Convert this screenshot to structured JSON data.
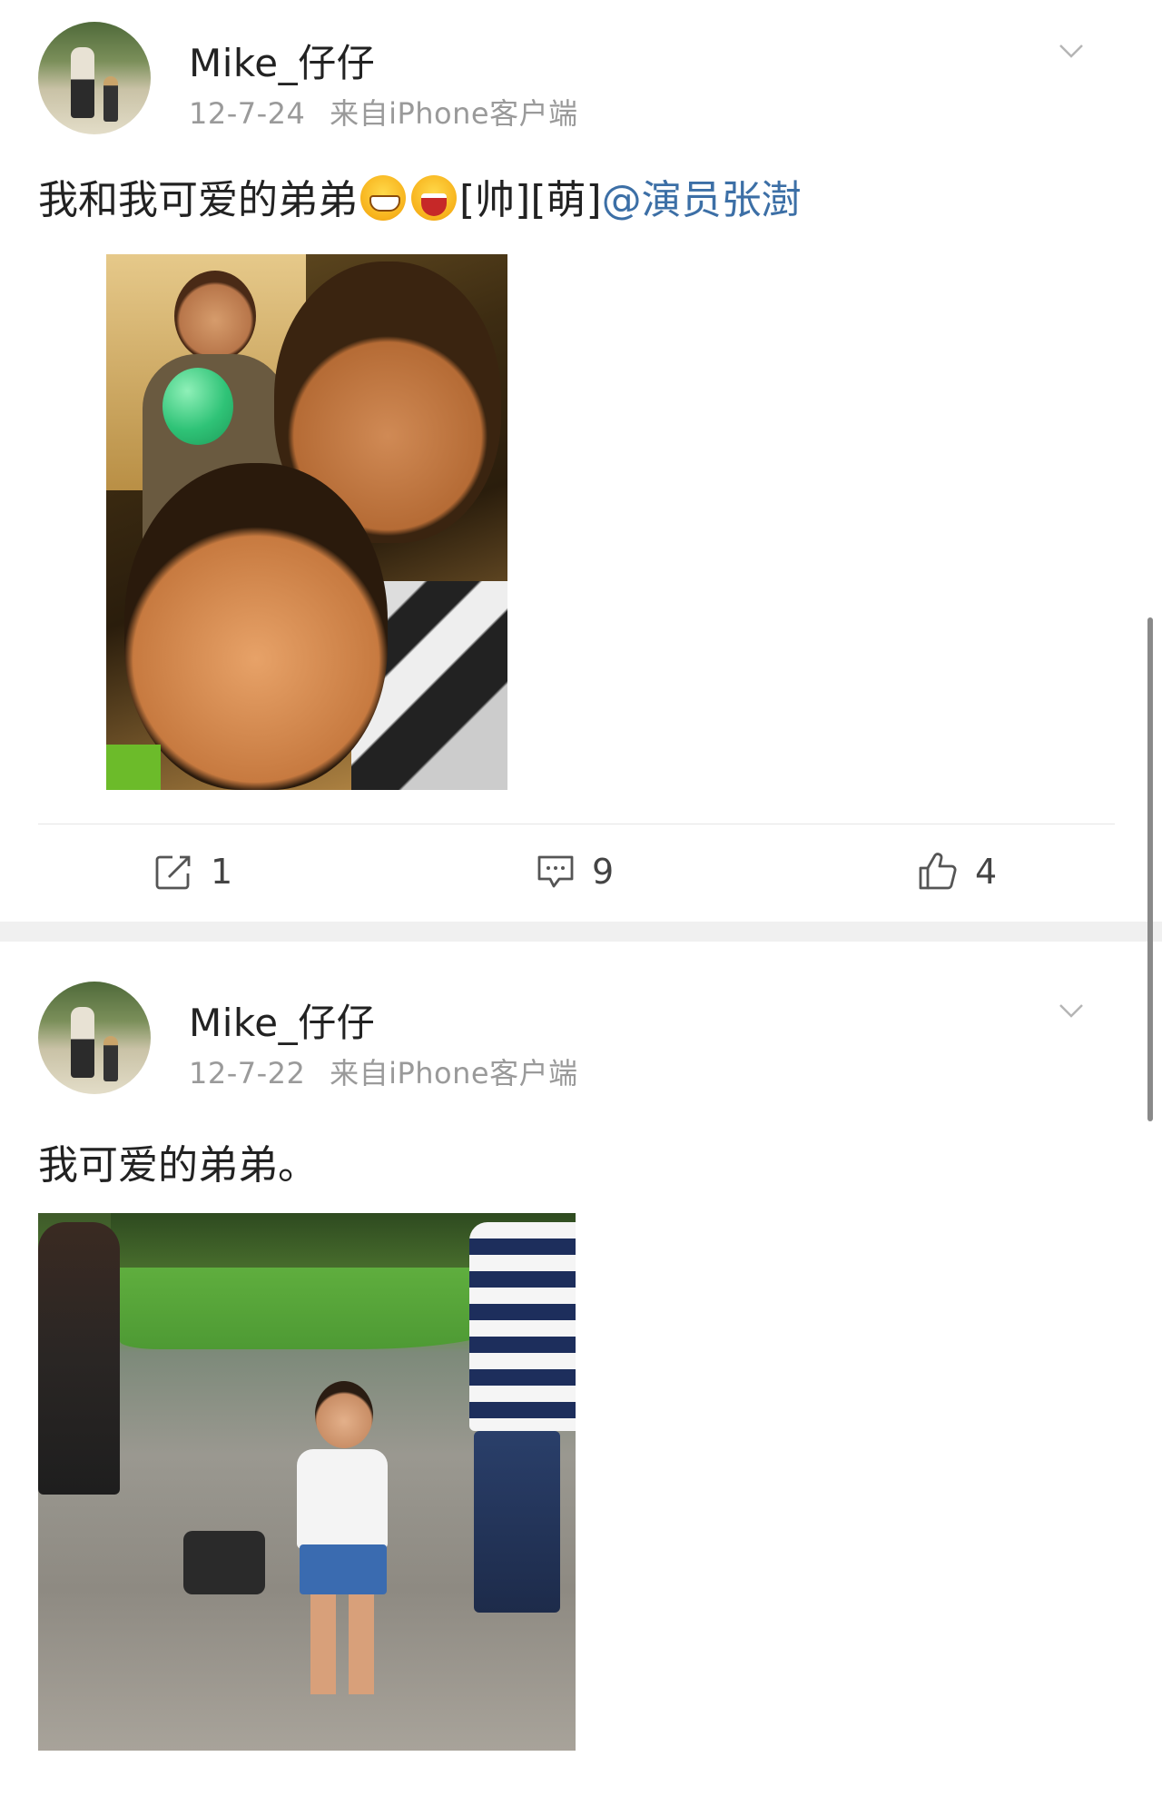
{
  "posts": [
    {
      "username": "Mike_仔仔",
      "timestamp": "12-7-24",
      "source": "来自iPhone客户端",
      "text_main": "我和我可爱的弟弟",
      "emoji": [
        "grin-emoji",
        "laugh-emoji"
      ],
      "tags": "[帅][萌]",
      "mention": "@演员张澍",
      "actions": {
        "repost_count": "1",
        "comment_count": "9",
        "like_count": "4"
      }
    },
    {
      "username": "Mike_仔仔",
      "timestamp": "12-7-22",
      "source": "来自iPhone客户端",
      "text_main": "我可爱的弟弟。"
    }
  ],
  "icons": [
    "chevron-down-icon",
    "repost-icon",
    "comment-icon",
    "like-icon"
  ],
  "colors": {
    "mention": "#3c6fa6",
    "meta": "#9a9a9a",
    "separator": "#f0f0f0"
  }
}
